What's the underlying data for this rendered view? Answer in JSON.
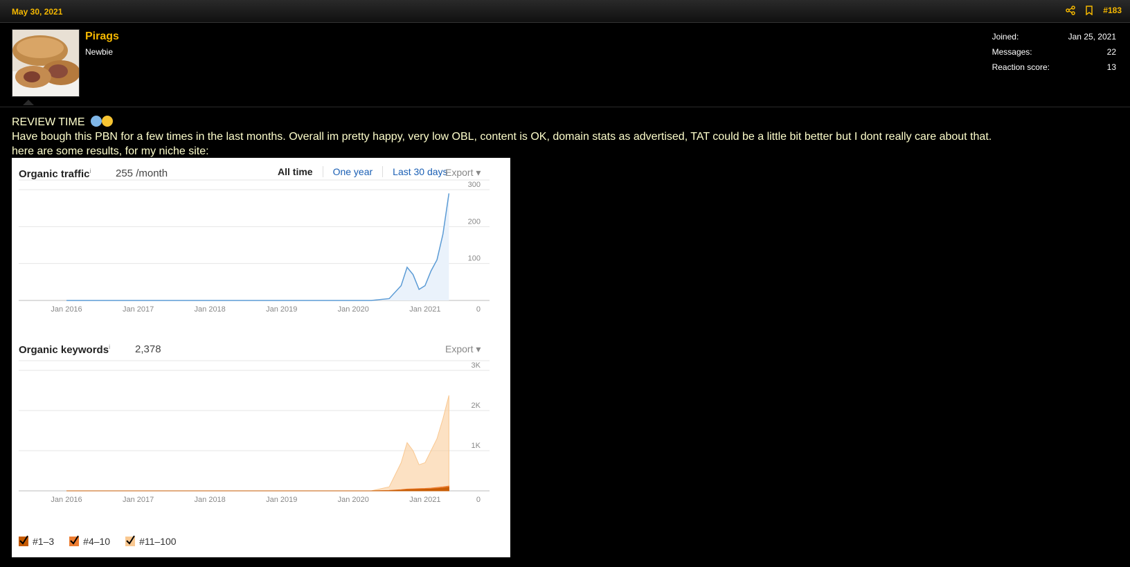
{
  "post": {
    "date": "May 30, 2021",
    "number": "#183"
  },
  "user": {
    "name": "Pirags",
    "title": "Newbie",
    "stats": [
      {
        "label": "Joined:",
        "value": "Jan 25, 2021"
      },
      {
        "label": "Messages:",
        "value": "22"
      },
      {
        "label": "Reaction score:",
        "value": "13"
      }
    ]
  },
  "body": {
    "line1": "REVIEW TIME",
    "line2": "Have bough this PBN for a few times in the last months. Overall im pretty happy, very low OBL, content is OK, domain stats as advertised, TAT could be a little bit better but I dont really care about that.",
    "line3": "here are some results, for my niche site:"
  },
  "report": {
    "traffic": {
      "title": "Organic traffic",
      "info": "i",
      "value": "255 /month",
      "tabs": [
        "All time",
        "One year",
        "Last 30 days"
      ],
      "export": "Export"
    },
    "keywords": {
      "title": "Organic keywords",
      "info": "i",
      "value": "2,378",
      "export": "Export",
      "legend": [
        "#1–3",
        "#4–10",
        "#11–100"
      ]
    },
    "colors": {
      "traffic": "#5b9bd5",
      "kw_top3": "#c55a00",
      "kw_4_10": "#ed7d31",
      "kw_11_100": "#f9c891",
      "accent": "#f5b800"
    }
  },
  "chart_data": [
    {
      "type": "line",
      "title": "Organic traffic",
      "x": [
        "Jan 2016",
        "Jan 2017",
        "Jan 2018",
        "Jan 2019",
        "Jan 2020",
        "Apr 2020",
        "Jul 2020",
        "Sep 2020",
        "Oct 2020",
        "Nov 2020",
        "Dec 2020",
        "Jan 2021",
        "Feb 2021",
        "Mar 2021",
        "Apr 2021",
        "May 2021"
      ],
      "x_ticks": [
        "Jan 2016",
        "Jan 2017",
        "Jan 2018",
        "Jan 2019",
        "Jan 2020",
        "Jan 2021"
      ],
      "series": [
        {
          "values": [
            0,
            0,
            0,
            0,
            0,
            0,
            5,
            40,
            90,
            70,
            30,
            40,
            80,
            110,
            180,
            290
          ]
        }
      ],
      "y_ticks": [
        "0",
        "100",
        "200",
        "300"
      ],
      "ylim": [
        0,
        300
      ]
    },
    {
      "type": "area",
      "title": "Organic keywords",
      "x": [
        "Jan 2016",
        "Jan 2017",
        "Jan 2018",
        "Jan 2019",
        "Jan 2020",
        "Apr 2020",
        "Jul 2020",
        "Sep 2020",
        "Oct 2020",
        "Nov 2020",
        "Dec 2020",
        "Jan 2021",
        "Feb 2021",
        "Mar 2021",
        "Apr 2021",
        "May 2021"
      ],
      "x_ticks": [
        "Jan 2016",
        "Jan 2017",
        "Jan 2018",
        "Jan 2019",
        "Jan 2020",
        "Jan 2021"
      ],
      "series": [
        {
          "name": "#1–3",
          "values": [
            0,
            0,
            0,
            0,
            0,
            0,
            5,
            15,
            25,
            30,
            35,
            40,
            45,
            55,
            70,
            90
          ]
        },
        {
          "name": "#4–10",
          "values": [
            0,
            0,
            0,
            0,
            0,
            0,
            10,
            30,
            45,
            50,
            55,
            60,
            70,
            85,
            100,
            120
          ]
        },
        {
          "name": "#11–100",
          "values": [
            0,
            0,
            0,
            0,
            0,
            0,
            100,
            700,
            1200,
            1000,
            650,
            700,
            1000,
            1300,
            1800,
            2378
          ]
        }
      ],
      "y_ticks": [
        "0",
        "1K",
        "2K",
        "3K"
      ],
      "ylim": [
        0,
        3000
      ]
    }
  ]
}
